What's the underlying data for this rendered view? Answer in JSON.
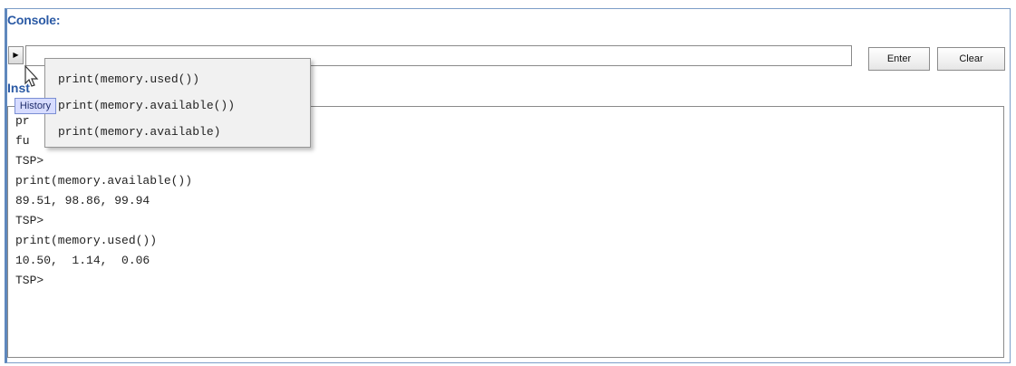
{
  "console": {
    "title": "Console:",
    "history_button_icon": "triangle-right-icon",
    "input": {
      "value": "",
      "placeholder": ""
    },
    "enter_label": "Enter",
    "clear_label": "Clear",
    "output_label": "Inst",
    "history_tooltip": "History"
  },
  "history_popup": {
    "items": [
      "print(memory.used())",
      "print(memory.available())",
      "print(memory.available)"
    ]
  },
  "output": {
    "lines": [
      "pr",
      "fu",
      "TSP>",
      "print(memory.available())",
      "89.51, 98.86, 99.94",
      "TSP>",
      "print(memory.used())",
      "10.50,  1.14,  0.06",
      "TSP>"
    ]
  }
}
